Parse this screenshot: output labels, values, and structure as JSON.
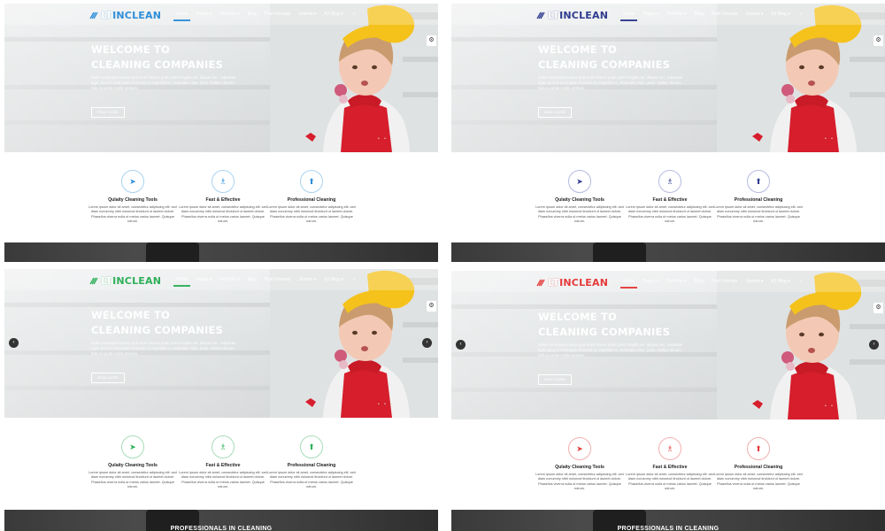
{
  "panels": [
    {
      "accent": "#2f8fd8",
      "accent_light": "#a9d3f2",
      "logo": {
        "lt": "LT",
        "name": "INCLEAN",
        "color": "#2f8fd8"
      },
      "menu": [
        "Home",
        "Pages ▾",
        "Portfolio ▾",
        "Blog",
        "Post Formats",
        "Joomla ▾",
        "K2 Blog ▾",
        "⌕"
      ],
      "active_index": 0,
      "headline": [
        "WELCOME TO",
        "CLEANING COMPANIES"
      ],
      "lead": "Nulla consequat massa quis enim Donec pede justo fringilla vel, aliquet nec, vulputate eget, arcu In enim justo rhoncus ut, imperdiet a, venenatis vitae, justo. Nullam dictum felis eu pede mollis pretium.",
      "read_more": "READ MORE",
      "show_arrows": false,
      "caption": ""
    },
    {
      "accent": "#2f3c8f",
      "accent_light": "#b5bbe0",
      "logo": {
        "lt": "LT",
        "name": "INCLEAN",
        "color": "#2f3c8f"
      },
      "menu": [
        "Home",
        "Pages ▾",
        "Portfolio ▾",
        "Blog",
        "Post Formats",
        "Joomla ▾",
        "K2 Blog ▾",
        "⌕"
      ],
      "active_index": 0,
      "headline": [
        "WELCOME TO",
        "CLEANING COMPANIES"
      ],
      "lead": "Nulla consequat massa quis enim Donec pede justo fringilla vel, aliquet nec, vulputate eget, arcu In enim justo rhoncus ut, imperdiet a, venenatis vitae, justo. Nullam dictum felis eu pede mollis pretium.",
      "read_more": "READ MORE",
      "show_arrows": false,
      "caption": ""
    },
    {
      "accent": "#2fb05a",
      "accent_light": "#a8ddb8",
      "logo": {
        "lt": "LT",
        "name": "INCLEAN",
        "color": "#2fb05a"
      },
      "menu": [
        "Home",
        "Pages ▾",
        "Portfolio ▾",
        "Blog",
        "Post Formats",
        "Joomla ▾",
        "K2 Blog ▾",
        "⌕"
      ],
      "active_index": 0,
      "headline": [
        "WELCOME TO",
        "CLEANING COMPANIES"
      ],
      "lead": "Nulla consequat massa quis enim Donec pede justo fringilla vel, aliquet nec, vulputate eget, arcu In enim justo rhoncus ut, imperdiet a, venenatis vitae, justo. Nullam dictum felis eu pede mollis pretium.",
      "read_more": "READ MORE",
      "show_arrows": true,
      "caption": "PROFESSIONALS IN CLEANING"
    },
    {
      "accent": "#e53b3b",
      "accent_light": "#f2b0b0",
      "logo": {
        "lt": "LT",
        "name": "INCLEAN",
        "color": "#e53b3b"
      },
      "menu": [
        "Home",
        "Pages ▾",
        "Portfolio ▾",
        "Blog",
        "Post Formats",
        "Joomla ▾",
        "K2 Blog ▾",
        "⌕"
      ],
      "active_index": 0,
      "headline": [
        "WELCOME TO",
        "CLEANING COMPANIES"
      ],
      "lead": "Nulla consequat massa quis enim Donec pede justo fringilla vel, aliquet nec, vulputate eget, arcu In enim justo rhoncus ut, imperdiet a, venenatis vitae, justo. Nullam dictum felis eu pede mollis pretium.",
      "read_more": "READ MORE",
      "show_arrows": true,
      "caption": "PROFESSIONALS IN CLEANING"
    }
  ],
  "features": [
    {
      "icon": "rocket-icon",
      "glyph": "➤",
      "title": "Qulaity Cleaning Tools",
      "desc": "Lorem ipsum dolor sit amet, consectetur adipiscing elit. sed diam nonummy nibh euismod tincidunt ut laoreet dolore. Phasellus viverra nulla ut metus varius laoreet. Quisque rutrum."
    },
    {
      "icon": "spray-bottle-icon",
      "glyph": "♗",
      "title": "Fast & Effective",
      "desc": "Lorem ipsum dolor sit amet, consectetur adipiscing elit. sed diam nonummy nibh euismod tincidunt ut laoreet dolore. Phasellus viverra nulla ut metus varius laoreet. Quisque rutrum."
    },
    {
      "icon": "arrow-up-icon",
      "glyph": "⬆",
      "title": "Professional Cleaning",
      "desc": "Lorem ipsum dolor sit amet, consectetur adipiscing elit. sed diam nonummy nibh euismod tincidunt ut laoreet dolore. Phasellus viverra nulla ut metus varius laoreet. Quisque rutrum."
    }
  ],
  "icons": {
    "gear": "gear-icon",
    "prev": "chevron-left-icon",
    "next": "chevron-right-icon"
  },
  "glyphs": {
    "gear": "⚙",
    "prev": "‹",
    "next": "›",
    "dots": "• • •"
  }
}
